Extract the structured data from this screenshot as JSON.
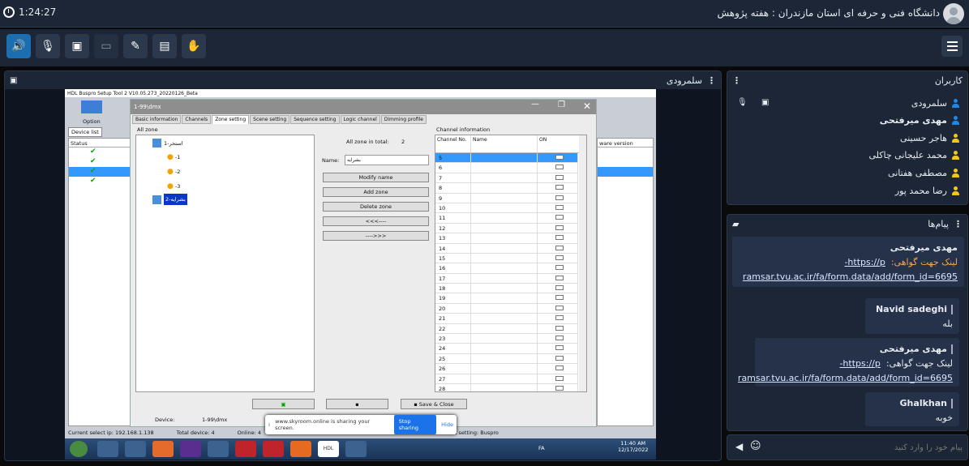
{
  "topbar": {
    "time": "1:24:27",
    "title": "دانشگاه فنی و حرفه ای استان مازندران : هفته پژوهش"
  },
  "toolbar": {
    "buttons": [
      "speaker-icon",
      "mic-off-icon",
      "video-off-icon",
      "screen-icon",
      "brush-icon",
      "file-icon",
      "hand-icon"
    ]
  },
  "share": {
    "presenter": "سلمرودی"
  },
  "users": {
    "title": "کاربران",
    "list": [
      "سلمرودی",
      "مهدی میرفتحی",
      "هاجر حسینی",
      "محمد علیجانی چاکلی",
      "مصطفی هفتانی",
      "رضا محمد پور"
    ]
  },
  "chat": {
    "title": "پیام‌ها",
    "messages": [
      {
        "author": "مهدی میرفتحی",
        "label": "لینک جهت گواهی:",
        "link1": "https://p-",
        "link2": "ramsar.tvu.ac.ir/fa/form.data/add/form_id=6695"
      },
      {
        "author": "Navid sadeghi",
        "text": "بله"
      },
      {
        "author": "مهدی میرفتحی",
        "label": "لینک جهت گواهی:",
        "link1": "https://p-",
        "link2": "ramsar.tvu.ac.ir/fa/form.data/add/form_id=6695"
      },
      {
        "author": "Ghalkhan",
        "text": "خوبه"
      }
    ],
    "placeholder": "پیام خود را وارد کنید"
  },
  "remote": {
    "app_title": "HDL Buspro Setup Tool 2 V10.05.273_20220126_Beta",
    "dialog_title": "1-99\\dmx",
    "tabs": [
      "Basic information",
      "Channels",
      "Zone setting",
      "Scene setting",
      "Sequence setting",
      "Logic channel",
      "Dimming profile"
    ],
    "all_zone": "All zone",
    "zone1": "استخر-1",
    "zone_lamps": [
      "-1",
      "-2",
      "-3"
    ],
    "zone2": "بشرایه-2",
    "zone_total_label": "All zone in total:",
    "zone_total": "2",
    "name_label": "Name:",
    "name_value": "بشرایه",
    "btn_modify": "Modify name",
    "btn_add": "Add zone",
    "btn_delete": "Delete zone",
    "btn_left": "<<<----",
    "btn_right": "---->>>",
    "channel_info": "Channel information",
    "col_channel": "Channel No.",
    "col_name": "Name",
    "col_on": "ON",
    "channels": [
      "5",
      "6",
      "7",
      "8",
      "9",
      "10",
      "11",
      "12",
      "13",
      "14",
      "15",
      "16",
      "17",
      "18",
      "19",
      "20",
      "21",
      "22",
      "23",
      "24",
      "25",
      "26",
      "27",
      "28"
    ],
    "device_label": "Device:",
    "device_value": "1-99\\dmx",
    "save_close": "Save & Close",
    "option": "Option",
    "device_list": "Device list",
    "status_col": "Status",
    "ware_version": "ware version",
    "status_bar": [
      "Current select ip:   192.168.1.138",
      "Total device:   4",
      "Online:   4",
      "current setting:   Buspro"
    ],
    "share_text": "www.skyroom.online is sharing your screen.",
    "stop_sharing": "Stop sharing",
    "hide": "Hide",
    "lang": "FA",
    "clock_time": "11:40 AM",
    "clock_date": "12/17/2022",
    "hdl_tb": "HDL"
  }
}
